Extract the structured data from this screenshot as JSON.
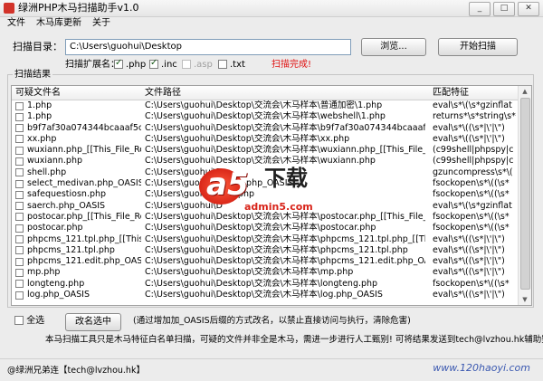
{
  "window": {
    "title": "绿洲PHP木马扫描助手v1.0",
    "buttons": [
      "_",
      "□",
      "✕"
    ]
  },
  "menu": [
    "文件",
    "木马库更新",
    "关于"
  ],
  "scan_dir": {
    "label": "扫描目录：",
    "value": "C:\\Users\\guohui\\Desktop"
  },
  "browse_button": "浏览...",
  "start_button": "开始扫描",
  "ext": {
    "label": "扫描扩展名：",
    "items": [
      {
        "text": ".php",
        "checked": true,
        "disabled": false
      },
      {
        "text": ".inc",
        "checked": true,
        "disabled": false
      },
      {
        "text": ".asp",
        "checked": false,
        "disabled": true
      },
      {
        "text": ".txt",
        "checked": false,
        "disabled": false
      }
    ]
  },
  "status_text": "扫描完成!",
  "results": {
    "group_label": "扫描结果",
    "headers": [
      "可疑文件名",
      "文件路径",
      "匹配特征"
    ],
    "rows": [
      [
        "1.php",
        "C:\\Users\\guohui\\Desktop\\交流会\\木马样本\\普通加密\\1.php",
        "eval\\s*\\(\\s*gzinflat"
      ],
      [
        "1.php",
        "C:\\Users\\guohui\\Desktop\\交流会\\木马样本\\webshell\\1.php",
        "returns*\\s*string\\s*"
      ],
      [
        "b9f7af30a074344bcaaaf5ceac9ff0...",
        "C:\\Users\\guohui\\Desktop\\交流会\\木马样本\\b9f7af30a074344bcaaaf5ceac9ff0...",
        "eval\\s*\\((\\s*|\\'|\\\")"
      ],
      [
        "xx.php",
        "C:\\Users\\guohui\\Desktop\\交流会\\木马样本\\xx.php",
        "eval\\s*\\((\\s*|\\'|\\\")"
      ],
      [
        "wuxiann.php_[[This_File_ReNam...",
        "C:\\Users\\guohui\\Desktop\\交流会\\木马样本\\wuxiann.php_[[This_File_ReName...",
        "(c99shell|phpspy|c"
      ],
      [
        "wuxiann.php",
        "C:\\Users\\guohui\\Desktop\\交流会\\木马样本\\wuxiann.php",
        "(c99shell|phpspy|c"
      ],
      [
        "shell.php",
        "C:\\Users\\guohui\\D",
        "gzuncompress\\s*\\("
      ],
      [
        "select_medivan.php_OASIS",
        "C:\\Users\\guohui\\D                    ivan.php_OASIS",
        "fsockopen\\s*\\((\\s*"
      ],
      [
        "safequestiosn.php",
        "C:\\Users\\guohui\\D                    sn.php",
        "fsockopen\\s*\\((\\s*"
      ],
      [
        "saerch.php_OASIS",
        "C:\\Users\\guohui\\D",
        "eval\\s*\\(\\s*gzinflat"
      ],
      [
        "postocar.php_[[This_File_ReNam...",
        "C:\\Users\\guohui\\Desktop\\交流会\\木马样本\\postocar.php_[[This_File_ReName...",
        "fsockopen\\s*\\((\\s*"
      ],
      [
        "postocar.php",
        "C:\\Users\\guohui\\Desktop\\交流会\\木马样本\\postocar.php",
        "fsockopen\\s*\\((\\s*"
      ],
      [
        "phpcms_121.tpl.php_[[This_Fil...",
        "C:\\Users\\guohui\\Desktop\\交流会\\木马样本\\phpcms_121.tpl.php_[[This_File_R...",
        "eval\\s*\\((\\s*|\\'|\\\")"
      ],
      [
        "phpcms_121.tpl.php",
        "C:\\Users\\guohui\\Desktop\\交流会\\木马样本\\phpcms_121.tpl.php",
        "eval\\s*\\((\\s*|\\'|\\\")"
      ],
      [
        "phpcms_121.edit.php_OASIS",
        "C:\\Users\\guohui\\Desktop\\交流会\\木马样本\\phpcms_121.edit.php_OASIS_00",
        "eval\\s*\\((\\s*|\\'|\\\")"
      ],
      [
        "mp.php",
        "C:\\Users\\guohui\\Desktop\\交流会\\木马样本\\mp.php",
        "eval\\s*\\((\\s*|\\'|\\\")"
      ],
      [
        "longteng.php",
        "C:\\Users\\guohui\\Desktop\\交流会\\木马样本\\longteng.php",
        "fsockopen\\s*\\((\\s*"
      ],
      [
        "log.php_OASIS",
        "C:\\Users\\guohui\\Desktop\\交流会\\木马样本\\log.php_OASIS",
        "eval\\s*\\((\\s*|\\'|\\\")"
      ]
    ]
  },
  "watermark": {
    "brand": "a5",
    "cn": "下载",
    "url": "admin5.com"
  },
  "select_all_label": "全选",
  "rename_button": "改名选中",
  "rename_note": "(通过增加加_OASIS后缀的方式改名，以禁止直接访问与执行，清除危害)",
  "footer_text": "本马扫描工具只是木马特征白名单扫描，可疑的文件并非全是木马，需进一步进行人工甄别! 可将结果发送到tech@lvzhou.hk辅助鉴定!",
  "statusbar": {
    "contact": "@绿洲兄弟连【tech@lvzhou.hk】",
    "site": "www.120haoyi.com"
  }
}
